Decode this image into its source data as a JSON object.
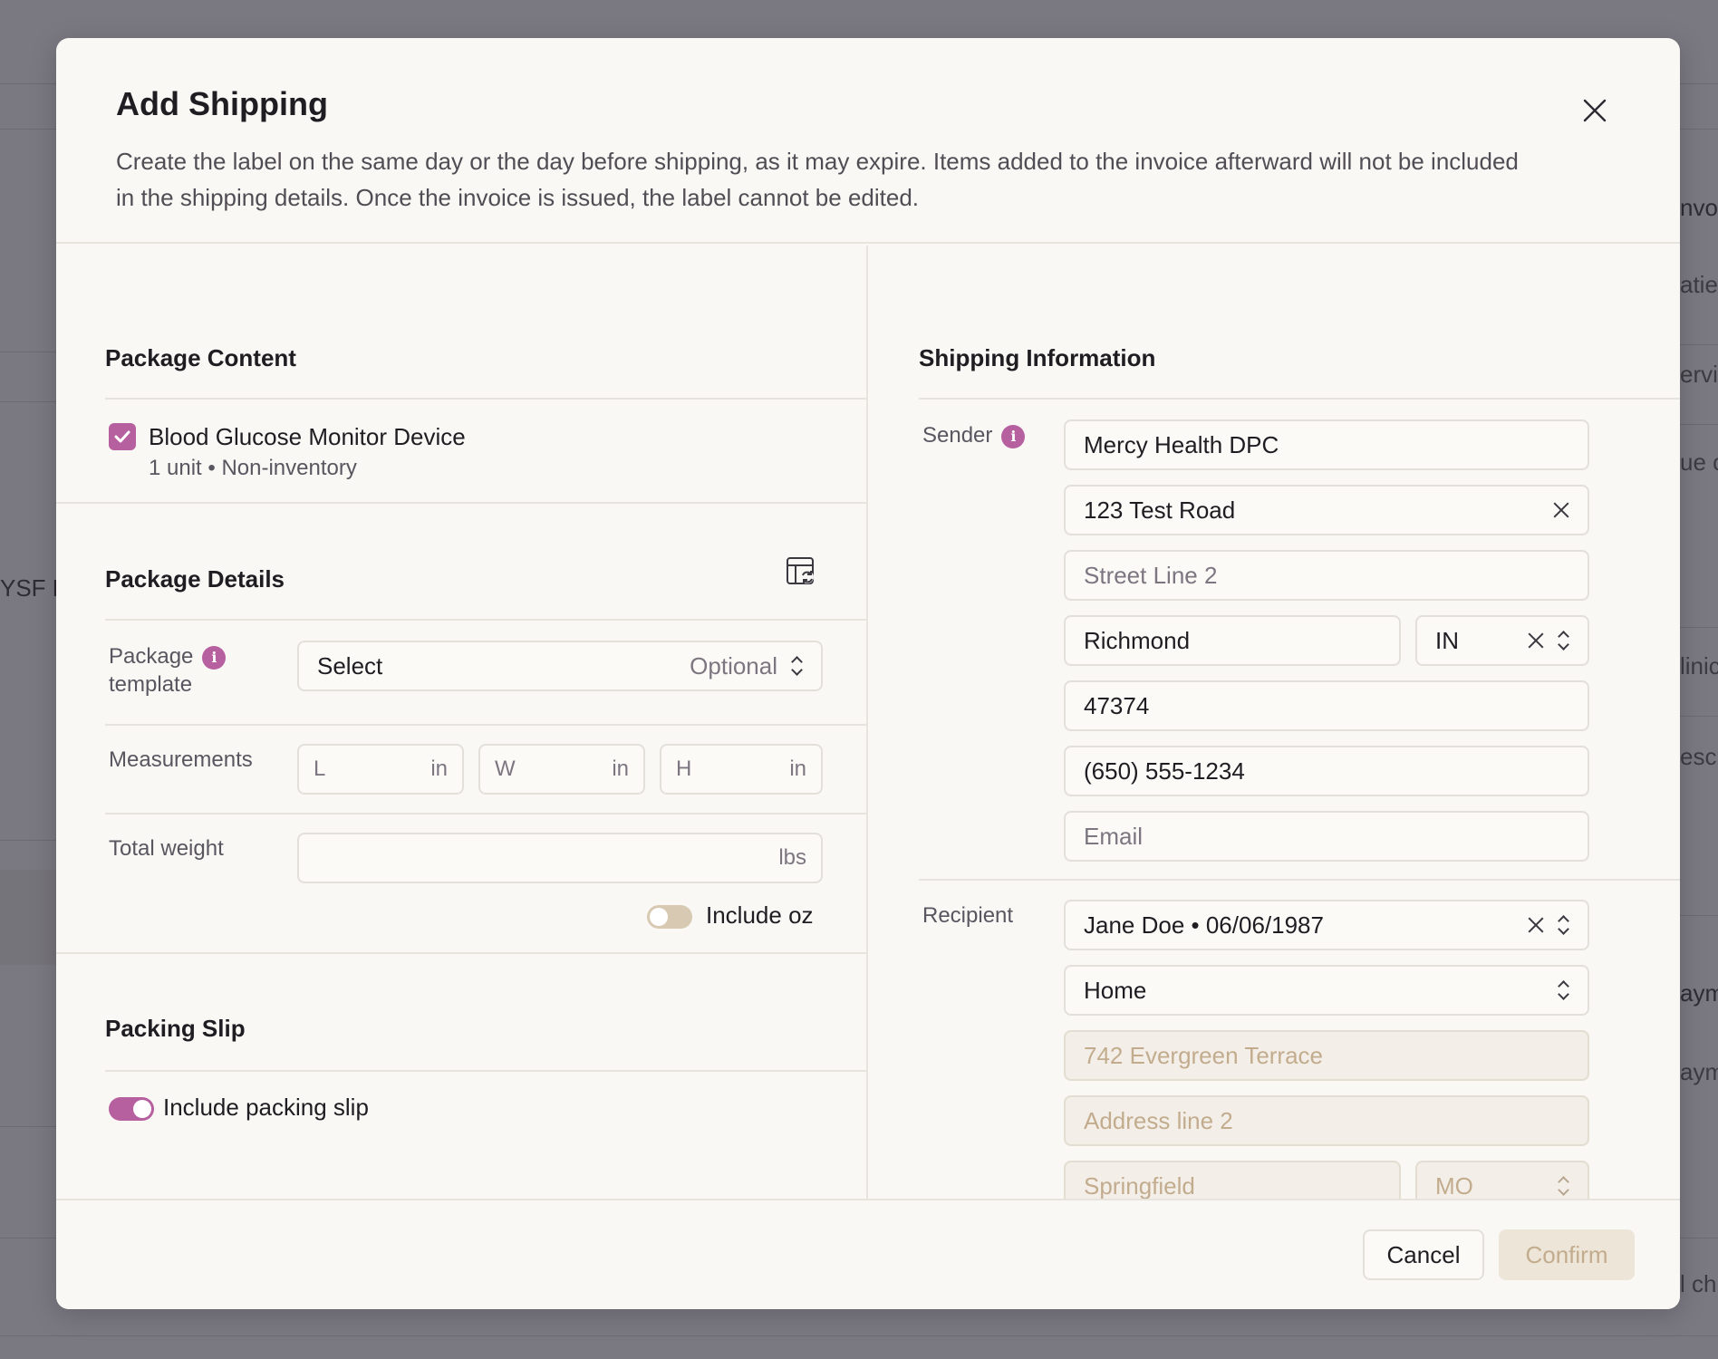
{
  "background": {
    "fragments": [
      "nvoi",
      "atie",
      "ervi",
      "ue c",
      "YSF F",
      "linic",
      "esc",
      "aym",
      "aym",
      "l ch"
    ]
  },
  "modal": {
    "title": "Add Shipping",
    "description": "Create the label on the same day or the day before shipping, as it may expire. Items added to the invoice afterward will not be included in the shipping details. Once the invoice is issued, the label cannot be edited."
  },
  "package_content": {
    "title": "Package Content",
    "item": {
      "name": "Blood Glucose Monitor Device",
      "sub": "1 unit • Non-inventory",
      "checked": true
    }
  },
  "package_details": {
    "title": "Package Details",
    "template_label": "Package template",
    "template_label_line1": "Package",
    "template_label_line2": "template",
    "template_value": "Select",
    "template_hint": "Optional",
    "measurements_label": "Measurements",
    "length_placeholder": "L",
    "width_placeholder": "W",
    "height_placeholder": "H",
    "unit_in": "in",
    "weight_label": "Total weight",
    "weight_unit": "lbs",
    "include_oz_label": "Include oz",
    "include_oz": false
  },
  "packing_slip": {
    "title": "Packing Slip",
    "include_label": "Include packing slip",
    "include": true
  },
  "shipping": {
    "title": "Shipping Information",
    "sender_label": "Sender",
    "sender": {
      "name": "Mercy Health DPC",
      "street1": "123 Test Road",
      "street2_placeholder": "Street Line 2",
      "city": "Richmond",
      "state": "IN",
      "zip": "47374",
      "phone": "(650) 555-1234",
      "email_placeholder": "Email"
    },
    "recipient_label": "Recipient",
    "recipient": {
      "patient": "Jane Doe • 06/06/1987",
      "address_type": "Home",
      "street1": "742 Evergreen Terrace",
      "street2_placeholder": "Address line 2",
      "city": "Springfield",
      "state": "MO"
    }
  },
  "footer": {
    "cancel_label": "Cancel",
    "confirm_label": "Confirm"
  },
  "colors": {
    "accent": "#b7609f",
    "disabled_text": "#c3ac8e",
    "overlay": "#7a7880"
  }
}
